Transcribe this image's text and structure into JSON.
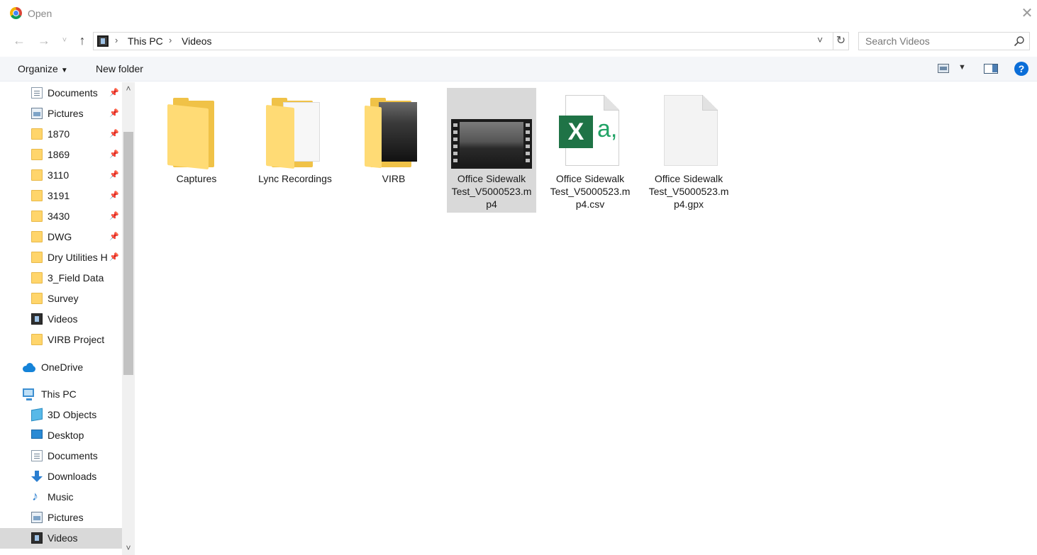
{
  "window": {
    "title": "Open",
    "close_glyph": "✕"
  },
  "nav": {
    "back_glyph": "←",
    "forward_glyph": "→",
    "recent_glyph": "˅",
    "up_glyph": "↑"
  },
  "address": {
    "separator": "›",
    "crumbs": [
      "This PC",
      "Videos"
    ],
    "dropdown_glyph": "˅",
    "refresh_glyph": "↻"
  },
  "search": {
    "placeholder": "Search Videos"
  },
  "toolbar": {
    "organize_label": "Organize",
    "organize_arrow": "▼",
    "new_folder_label": "New folder",
    "view_dd_glyph": "▼",
    "help_label": "?"
  },
  "sidebar": {
    "pin_glyph": "📌",
    "items": [
      {
        "label": "Documents",
        "icon": "documents-icon",
        "pinned": true
      },
      {
        "label": "Pictures",
        "icon": "pictures-icon",
        "pinned": true
      },
      {
        "label": "1870",
        "icon": "folder-icon",
        "pinned": true
      },
      {
        "label": "1869",
        "icon": "folder-icon",
        "pinned": true
      },
      {
        "label": "3110",
        "icon": "folder-icon",
        "pinned": true
      },
      {
        "label": "3191",
        "icon": "folder-icon",
        "pinned": true
      },
      {
        "label": "3430",
        "icon": "folder-icon",
        "pinned": true
      },
      {
        "label": "DWG",
        "icon": "folder-icon",
        "pinned": true
      },
      {
        "label": "Dry Utilities H",
        "icon": "folder-icon",
        "pinned": true
      },
      {
        "label": "3_Field Data",
        "icon": "folder-icon",
        "pinned": false
      },
      {
        "label": "Survey",
        "icon": "folder-icon",
        "pinned": false
      },
      {
        "label": "Videos",
        "icon": "videos-icon",
        "pinned": false
      },
      {
        "label": "VIRB Project",
        "icon": "folder-icon",
        "pinned": false
      }
    ],
    "onedrive": "OneDrive",
    "this_pc": "This PC",
    "pc_items": [
      {
        "label": "3D Objects",
        "icon": "3d-objects-icon"
      },
      {
        "label": "Desktop",
        "icon": "desktop-icon"
      },
      {
        "label": "Documents",
        "icon": "documents-icon"
      },
      {
        "label": "Downloads",
        "icon": "downloads-icon"
      },
      {
        "label": "Music",
        "icon": "music-icon"
      },
      {
        "label": "Pictures",
        "icon": "pictures-icon"
      },
      {
        "label": "Videos",
        "icon": "videos-icon",
        "selected": true
      }
    ],
    "scroll_up": "˄",
    "scroll_down": "˅"
  },
  "files": [
    {
      "name": "Captures",
      "type": "folder"
    },
    {
      "name": "Lync Recordings",
      "type": "folder"
    },
    {
      "name": "VIRB",
      "type": "folder"
    },
    {
      "name": "Office Sidewalk Test_V5000523.mp4",
      "type": "video",
      "selected": true
    },
    {
      "name": "Office Sidewalk Test_V5000523.mp4.csv",
      "type": "excel"
    },
    {
      "name": "Office Sidewalk Test_V5000523.mp4.gpx",
      "type": "file"
    }
  ],
  "excel_icon": {
    "x": "X",
    "a": "a,"
  },
  "colors": {
    "selection": "#d9d9d9",
    "folder": "#ffd56b",
    "excel": "#1f7346",
    "help": "#0b6ed8"
  }
}
